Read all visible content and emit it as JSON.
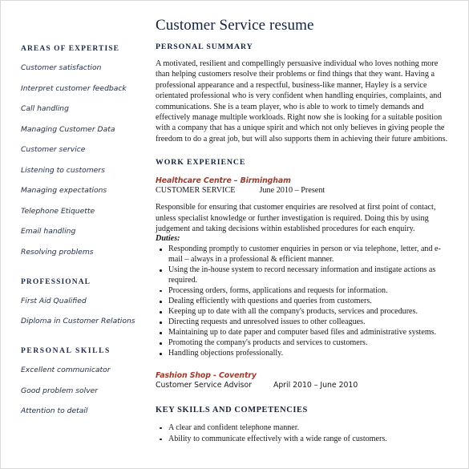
{
  "document": {
    "title": "Customer Service resume",
    "accent_color": "#a03a2b",
    "heading_color": "#16233d"
  },
  "sidebar": {
    "sections": [
      {
        "heading": "AREAS OF EXPERTISE",
        "items": [
          "Customer satisfaction",
          "Interpret customer feedback",
          "Call handling",
          "Managing Customer Data",
          "Customer service",
          "Listening to customers",
          "Managing expectations",
          "Telephone Etiquette",
          "Email handling",
          "Resolving problems"
        ]
      },
      {
        "heading": "PROFESSIONAL",
        "items": [
          "First Aid Qualified",
          "Diploma in Customer Relations"
        ]
      },
      {
        "heading": "PERSONAL SKILLS",
        "items": [
          "Excellent communicator",
          "Good problem solver",
          "Attention to detail"
        ]
      }
    ]
  },
  "main": {
    "personal_summary": {
      "heading": "PERSONAL SUMMARY",
      "text": "A motivated, resilient and compellingly persuasive individual who loves nothing more than helping customers resolve their problems or find things that they want. Having a professional appearance and a respectful, business-like manner, Hayley is a service orientated professional who is very confident when handling enquiries, complaints, and communications. She is a team player, who is able to work to timely demands and effectively manage multiple workloads. Right now she is looking for a suitable position with a company that has a unique spirit and which not only believes in giving people the freedom to do a great job, but will also supports them in achieving their future ambitions."
    },
    "work_experience": {
      "heading": "WORK EXPERIENCE",
      "job1": {
        "employer": "Healthcare Centre – Birmingham",
        "role": "CUSTOMER SERVICE",
        "dates": "June 2010 – Present",
        "description": "Responsible for ensuring that customer enquiries are resolved at first point of contact, unless specialist knowledge or further investigation is required. Doing this by using judgement and taking decisions within established procedures for each enquiry.",
        "duties_label": "Duties:",
        "duties": [
          "Responding promptly to customer enquiries in person or via telephone, letter, and e-mail – always in a professional & efficient manner.",
          "Using the in-house system to record necessary information and instigate actions as required.",
          "Processing orders, forms, applications and requests for information.",
          "Dealing efficiently with questions and queries from customers.",
          "Keeping up to date with all the company's products, services and procedures.",
          "Directing requests and unresolved issues to other colleagues.",
          "Maintaining up to date paper and computer based files and administrative systems.",
          "Promoting the company's products and services to customers.",
          "Handling objections professionally."
        ]
      },
      "job2": {
        "employer": "Fashion Shop - Coventry",
        "role": "Customer Service Advisor",
        "dates": "April 2010 – June 2010"
      }
    },
    "key_skills": {
      "heading": "KEY SKILLS AND COMPETENCIES",
      "items": [
        "A clear and confident telephone manner.",
        "Ability to communicate effectively with a wide range of customers."
      ]
    }
  }
}
